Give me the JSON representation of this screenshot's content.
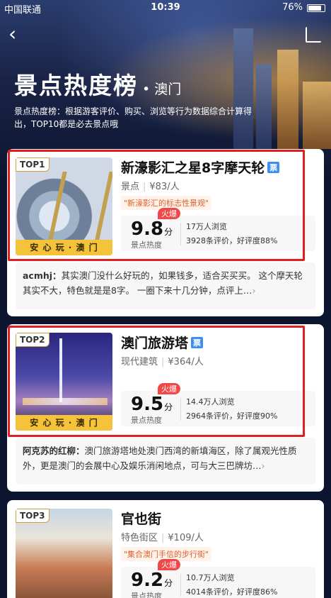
{
  "status": {
    "carrier": "中国联通",
    "time": "10:39",
    "battery": "76%"
  },
  "header": {
    "title": "景点热度榜",
    "location": "• 澳门",
    "description": "景点热度榜：根据游客评价、购买、浏览等行为数据综合计算得出，TOP10都是必去景点哦"
  },
  "badge_safe": "安 心 玩 · 澳 门",
  "ticket_label": "票",
  "hot_label": "火爆",
  "score_unit": "分",
  "heat_label": "景点热度",
  "items": [
    {
      "rank": "TOP1",
      "name": "新濠影汇之星8字摩天轮",
      "category": "景点",
      "price": "¥83/人",
      "tagline": "\"新濠影汇的标志性景观\"",
      "score": "9.8",
      "views": "17万人浏览",
      "reviews": "3928条评价，好评度88%",
      "comment_user": "acmhj：",
      "comment_text": "其实澳门没什么好玩的，如果钱多，适合买买买。 这个摩天轮其实不大，特色就是是8字。 一圈下来十几分钟，点评上…"
    },
    {
      "rank": "TOP2",
      "name": "澳门旅游塔",
      "category": "现代建筑",
      "price": "¥364/人",
      "tagline": "",
      "score": "9.5",
      "views": "14.4万人浏览",
      "reviews": "2964条评价，好评度90%",
      "comment_user": "阿克苏的红柳：",
      "comment_text": "澳门旅游塔地处澳门西湾的新填海区，除了属观光性质外，更是澳门的会展中心及娱乐消闲地点，可与大三巴牌坊…"
    },
    {
      "rank": "TOP3",
      "name": "官也街",
      "category": "特色街区",
      "price": "¥109/人",
      "tagline": "\"集合澳门手信的步行街\"",
      "score": "9.2",
      "views": "10.7万人浏览",
      "reviews": "4014条评价，好评度86%"
    }
  ]
}
